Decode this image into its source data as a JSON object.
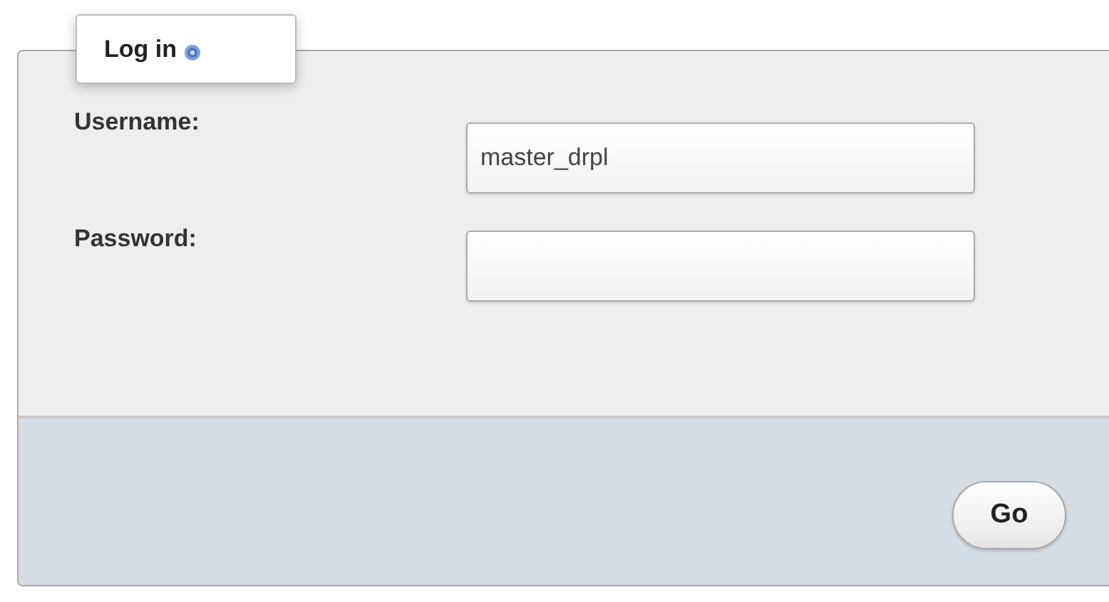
{
  "legend": {
    "title": "Log in"
  },
  "fields": [
    {
      "label": "Username:",
      "value": "master_drpl"
    },
    {
      "label": "Password:"
    }
  ],
  "buttons": [
    {
      "label": "Go"
    }
  ]
}
